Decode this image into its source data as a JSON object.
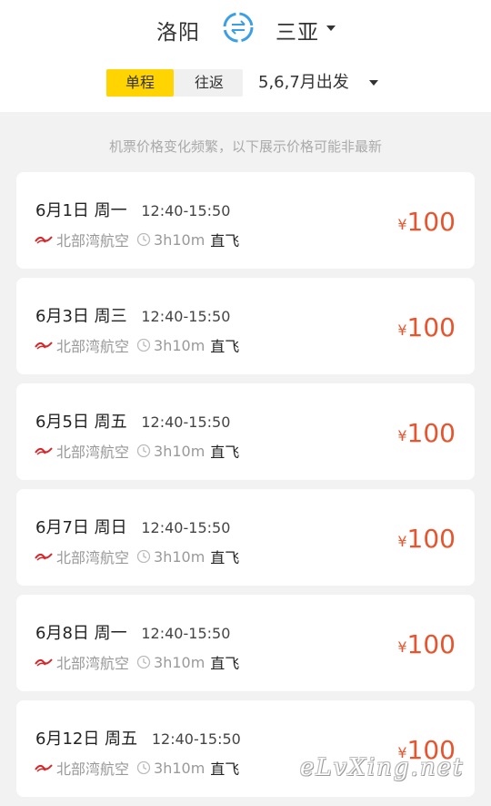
{
  "header": {
    "from_city": "洛阳",
    "to_city": "三亚",
    "trip_types": [
      "单程",
      "往返"
    ],
    "selected_trip_type": "单程",
    "date_range": "5,6,7月出发",
    "accent_color": "#ffd400",
    "swap_icon": "swap-icon"
  },
  "notice": "机票价格变化频繁，以下展示价格可能非最新",
  "flights": [
    {
      "date": "6月1日",
      "weekday": "周一",
      "time": "12:40-15:50",
      "airline": "北部湾航空",
      "duration": "3h10m",
      "type": "直飞",
      "currency": "¥",
      "price": "100"
    },
    {
      "date": "6月3日",
      "weekday": "周三",
      "time": "12:40-15:50",
      "airline": "北部湾航空",
      "duration": "3h10m",
      "type": "直飞",
      "currency": "¥",
      "price": "100"
    },
    {
      "date": "6月5日",
      "weekday": "周五",
      "time": "12:40-15:50",
      "airline": "北部湾航空",
      "duration": "3h10m",
      "type": "直飞",
      "currency": "¥",
      "price": "100"
    },
    {
      "date": "6月7日",
      "weekday": "周日",
      "time": "12:40-15:50",
      "airline": "北部湾航空",
      "duration": "3h10m",
      "type": "直飞",
      "currency": "¥",
      "price": "100"
    },
    {
      "date": "6月8日",
      "weekday": "周一",
      "time": "12:40-15:50",
      "airline": "北部湾航空",
      "duration": "3h10m",
      "type": "直飞",
      "currency": "¥",
      "price": "100"
    },
    {
      "date": "6月12日",
      "weekday": "周五",
      "time": "12:40-15:50",
      "airline": "北部湾航空",
      "duration": "3h10m",
      "type": "直飞",
      "currency": "¥",
      "price": "100"
    }
  ],
  "price_color": "#e7552f",
  "watermark": "eLvXing.net"
}
